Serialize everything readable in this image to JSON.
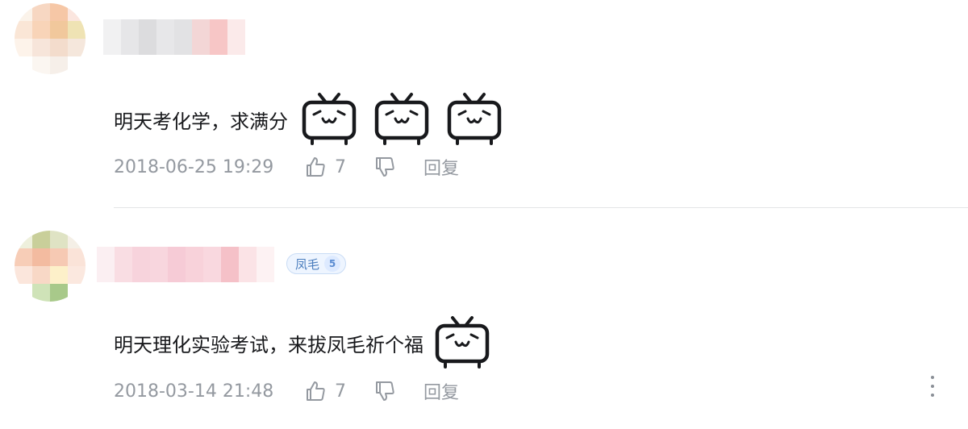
{
  "comments": [
    {
      "text": "明天考化学，求满分",
      "timestamp": "2018-06-25 19:29",
      "like_count": "7",
      "reply_label": "回复",
      "emotes": [
        "tv-smile-icon",
        "tv-smile-icon",
        "tv-smile-icon"
      ]
    },
    {
      "text": "明天理化实验考试，来拔凤毛祈个福",
      "timestamp": "2018-03-14 21:48",
      "like_count": "7",
      "reply_label": "回复",
      "fan_badge": {
        "name": "凤毛",
        "level": "5"
      },
      "emotes": [
        "tv-smile-icon"
      ]
    }
  ],
  "icons": {
    "like": "thumbs-up-icon",
    "dislike": "thumbs-down-icon",
    "more": "more-vertical-icon"
  },
  "colors": {
    "text_primary": "#18191c",
    "text_secondary": "#9499a0",
    "badge_text": "#4a7dbd",
    "badge_bg": "#eef5ff"
  }
}
